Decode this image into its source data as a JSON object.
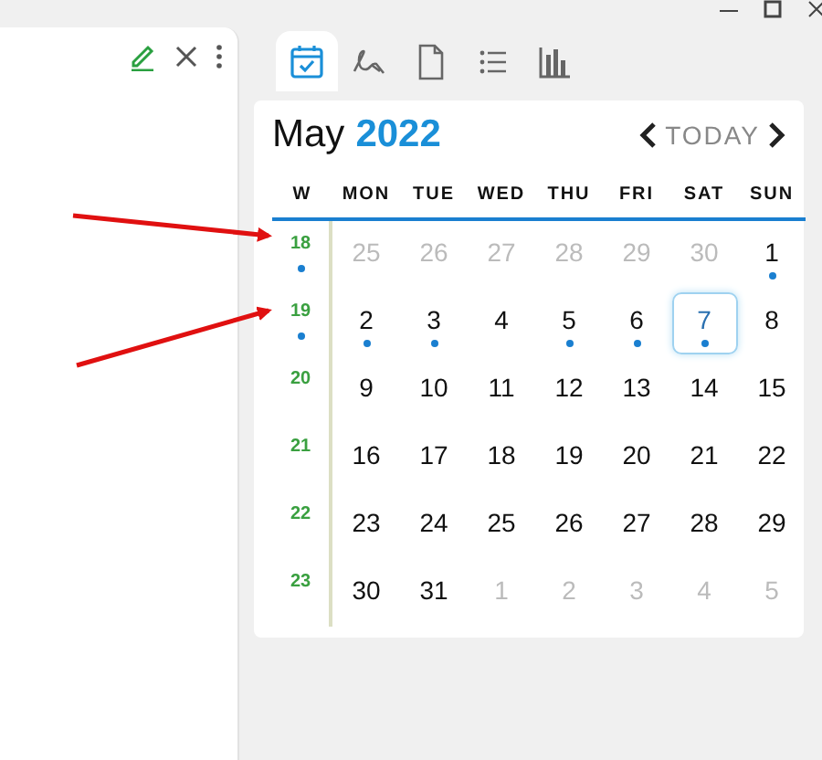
{
  "tabs": [
    {
      "kind": "calendar",
      "selected": true
    },
    {
      "kind": "signature",
      "selected": false
    },
    {
      "kind": "document",
      "selected": false
    },
    {
      "kind": "list",
      "selected": false
    },
    {
      "kind": "chart",
      "selected": false
    }
  ],
  "calendar": {
    "month": "May",
    "year": "2022",
    "today": "TODAY",
    "week_header": "W",
    "weekdays": [
      "MON",
      "TUE",
      "WED",
      "THU",
      "FRI",
      "SAT",
      "SUN"
    ],
    "weeks": [
      {
        "number": "18",
        "marked": true,
        "days": [
          {
            "day": "25",
            "outside": true,
            "dot": false,
            "selected": false
          },
          {
            "day": "26",
            "outside": true,
            "dot": false,
            "selected": false
          },
          {
            "day": "27",
            "outside": true,
            "dot": false,
            "selected": false
          },
          {
            "day": "28",
            "outside": true,
            "dot": false,
            "selected": false
          },
          {
            "day": "29",
            "outside": true,
            "dot": false,
            "selected": false
          },
          {
            "day": "30",
            "outside": true,
            "dot": false,
            "selected": false
          },
          {
            "day": "1",
            "outside": false,
            "dot": true,
            "selected": false
          }
        ]
      },
      {
        "number": "19",
        "marked": true,
        "days": [
          {
            "day": "2",
            "outside": false,
            "dot": true,
            "selected": false
          },
          {
            "day": "3",
            "outside": false,
            "dot": true,
            "selected": false
          },
          {
            "day": "4",
            "outside": false,
            "dot": false,
            "selected": false
          },
          {
            "day": "5",
            "outside": false,
            "dot": true,
            "selected": false
          },
          {
            "day": "6",
            "outside": false,
            "dot": true,
            "selected": false
          },
          {
            "day": "7",
            "outside": false,
            "dot": true,
            "selected": true
          },
          {
            "day": "8",
            "outside": false,
            "dot": false,
            "selected": false
          }
        ]
      },
      {
        "number": "20",
        "marked": false,
        "days": [
          {
            "day": "9",
            "outside": false,
            "dot": false,
            "selected": false
          },
          {
            "day": "10",
            "outside": false,
            "dot": false,
            "selected": false
          },
          {
            "day": "11",
            "outside": false,
            "dot": false,
            "selected": false
          },
          {
            "day": "12",
            "outside": false,
            "dot": false,
            "selected": false
          },
          {
            "day": "13",
            "outside": false,
            "dot": false,
            "selected": false
          },
          {
            "day": "14",
            "outside": false,
            "dot": false,
            "selected": false
          },
          {
            "day": "15",
            "outside": false,
            "dot": false,
            "selected": false
          }
        ]
      },
      {
        "number": "21",
        "marked": false,
        "days": [
          {
            "day": "16",
            "outside": false,
            "dot": false,
            "selected": false
          },
          {
            "day": "17",
            "outside": false,
            "dot": false,
            "selected": false
          },
          {
            "day": "18",
            "outside": false,
            "dot": false,
            "selected": false
          },
          {
            "day": "19",
            "outside": false,
            "dot": false,
            "selected": false
          },
          {
            "day": "20",
            "outside": false,
            "dot": false,
            "selected": false
          },
          {
            "day": "21",
            "outside": false,
            "dot": false,
            "selected": false
          },
          {
            "day": "22",
            "outside": false,
            "dot": false,
            "selected": false
          }
        ]
      },
      {
        "number": "22",
        "marked": false,
        "days": [
          {
            "day": "23",
            "outside": false,
            "dot": false,
            "selected": false
          },
          {
            "day": "24",
            "outside": false,
            "dot": false,
            "selected": false
          },
          {
            "day": "25",
            "outside": false,
            "dot": false,
            "selected": false
          },
          {
            "day": "26",
            "outside": false,
            "dot": false,
            "selected": false
          },
          {
            "day": "27",
            "outside": false,
            "dot": false,
            "selected": false
          },
          {
            "day": "28",
            "outside": false,
            "dot": false,
            "selected": false
          },
          {
            "day": "29",
            "outside": false,
            "dot": false,
            "selected": false
          }
        ]
      },
      {
        "number": "23",
        "marked": false,
        "days": [
          {
            "day": "30",
            "outside": false,
            "dot": false,
            "selected": false
          },
          {
            "day": "31",
            "outside": false,
            "dot": false,
            "selected": false
          },
          {
            "day": "1",
            "outside": true,
            "dot": false,
            "selected": false
          },
          {
            "day": "2",
            "outside": true,
            "dot": false,
            "selected": false
          },
          {
            "day": "3",
            "outside": true,
            "dot": false,
            "selected": false
          },
          {
            "day": "4",
            "outside": true,
            "dot": false,
            "selected": false
          },
          {
            "day": "5",
            "outside": true,
            "dot": false,
            "selected": false
          }
        ]
      }
    ]
  }
}
